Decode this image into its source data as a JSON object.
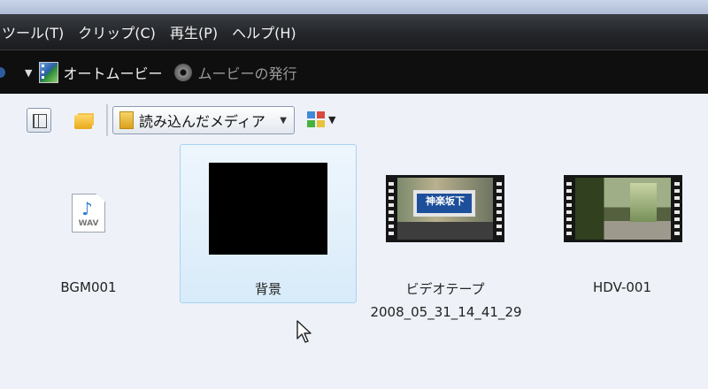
{
  "menubar": {
    "items": [
      "ツール(T)",
      "クリップ(C)",
      "再生(P)",
      "ヘルプ(H)"
    ]
  },
  "toolbar": {
    "autoMovie": "オートムービー",
    "publishMovie": "ムービーの発行"
  },
  "collectionBar": {
    "dropdownValue": "読み込んだメディア"
  },
  "clips": [
    {
      "title": "BGM001",
      "subtitle": "",
      "icon": "wav-file-icon",
      "iconText": "WAV"
    },
    {
      "title": "背景",
      "subtitle": "",
      "selected": true
    },
    {
      "title": "ビデオテープ",
      "subtitle": "2008_05_31_14_41_29",
      "thumbText": "神楽坂下"
    },
    {
      "title": "HDV-001",
      "subtitle": ""
    }
  ],
  "colors": {
    "menubar": "#24262a",
    "toolbar": "#0f0f10",
    "content": "#eef2f8",
    "selection": "#d8ebf9"
  }
}
